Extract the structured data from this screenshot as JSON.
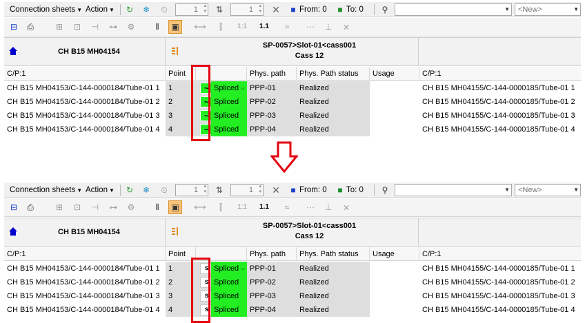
{
  "toolbar": {
    "connection_sheets": "Connection sheets",
    "action": "Action",
    "spin1_value": "1",
    "spin2_value": "1",
    "from_label": "From: 0",
    "to_label": "To: 0",
    "new_placeholder": "<New>"
  },
  "header": {
    "left_title": "CH B15 MH04154",
    "mid_title_line1": "SP-0057>Slot-01<cass001",
    "mid_title_line2": "Cass 12"
  },
  "columns": {
    "cp_left": "C/P:1",
    "point": "Point",
    "phys_path": "Phys. path",
    "phys_path_status": "Phys. Path status",
    "usage": "Usage",
    "cp_right": "C/P:1"
  },
  "rows": [
    {
      "left": "CH B15 MH04153/C-144-0000184/Tube-01 1",
      "point": "1",
      "status": "Spliced",
      "path": "PPP-01",
      "path_status": "Realized",
      "right": "CH B15 MH04155/C-144-0000185/Tube-01 1"
    },
    {
      "left": "CH B15 MH04153/C-144-0000184/Tube-01 2",
      "point": "2",
      "status": "Spliced",
      "path": "PPP-02",
      "path_status": "Realized",
      "right": "CH B15 MH04155/C-144-0000185/Tube-01 2"
    },
    {
      "left": "CH B15 MH04153/C-144-0000184/Tube-01 3",
      "point": "3",
      "status": "Spliced",
      "path": "PPP-03",
      "path_status": "Realized",
      "right": "CH B15 MH04155/C-144-0000185/Tube-01 3"
    },
    {
      "left": "CH B15 MH04153/C-144-0000184/Tube-01 4",
      "point": "4",
      "status": "Spliced",
      "path": "PPP-04",
      "path_status": "Realized",
      "right": "CH B15 MH04155/C-144-0000185/Tube-01 4"
    }
  ],
  "markers": {
    "top_symbol": "~",
    "bottom_symbol": "s"
  },
  "colors": {
    "spliced_green": "#22ee22",
    "highlight_red": "#e3000f",
    "home_blue": "#0000cc"
  }
}
